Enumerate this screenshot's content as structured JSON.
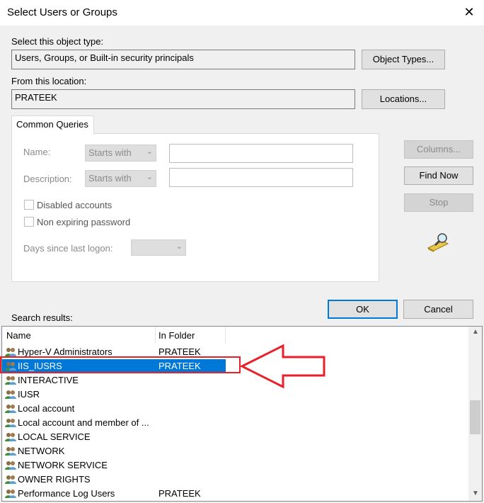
{
  "window": {
    "title": "Select Users or Groups",
    "close_symbol": "✕"
  },
  "object_type": {
    "label": "Select this object type:",
    "value": "Users, Groups, or Built-in security principals",
    "button": "Object Types..."
  },
  "location": {
    "label": "From this location:",
    "value": "PRATEEK",
    "button": "Locations..."
  },
  "queries": {
    "tab": "Common Queries",
    "name_label": "Name:",
    "name_mode": "Starts with",
    "description_label": "Description:",
    "description_mode": "Starts with",
    "disabled_accounts": "Disabled accounts",
    "non_expiring": "Non expiring password",
    "days_label": "Days since last logon:"
  },
  "side_buttons": {
    "columns": "Columns...",
    "find_now": "Find Now",
    "stop": "Stop"
  },
  "dialog_buttons": {
    "ok": "OK",
    "cancel": "Cancel"
  },
  "results": {
    "label": "Search results:",
    "columns": [
      "Name",
      "In Folder"
    ],
    "rows": [
      {
        "name": "Hyper-V Administrators",
        "folder": "PRATEEK"
      },
      {
        "name": "IIS_IUSRS",
        "folder": "PRATEEK",
        "selected": true
      },
      {
        "name": "INTERACTIVE",
        "folder": ""
      },
      {
        "name": "IUSR",
        "folder": ""
      },
      {
        "name": "Local account",
        "folder": ""
      },
      {
        "name": "Local account and member of ...",
        "folder": ""
      },
      {
        "name": "LOCAL SERVICE",
        "folder": ""
      },
      {
        "name": "NETWORK",
        "folder": ""
      },
      {
        "name": "NETWORK SERVICE",
        "folder": ""
      },
      {
        "name": "OWNER RIGHTS",
        "folder": ""
      },
      {
        "name": "Performance Log Users",
        "folder": "PRATEEK"
      }
    ]
  },
  "colors": {
    "selection": "#0078d7",
    "annotation": "#e8202a"
  }
}
